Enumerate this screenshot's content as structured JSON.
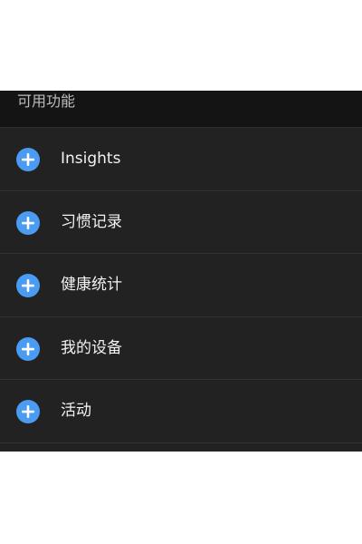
{
  "section": {
    "title": "可用功能"
  },
  "items": [
    {
      "label": "Insights",
      "icon": "add-circle-icon"
    },
    {
      "label": "习惯记录",
      "icon": "add-circle-icon"
    },
    {
      "label": "健康统计",
      "icon": "add-circle-icon"
    },
    {
      "label": "我的设备",
      "icon": "add-circle-icon"
    },
    {
      "label": "活动",
      "icon": "add-circle-icon"
    }
  ],
  "colors": {
    "background": "#232324",
    "header_background": "#141414",
    "accent": "#4a9cf2",
    "text_primary": "#f2f2f2",
    "text_secondary": "#bdbdbd"
  }
}
